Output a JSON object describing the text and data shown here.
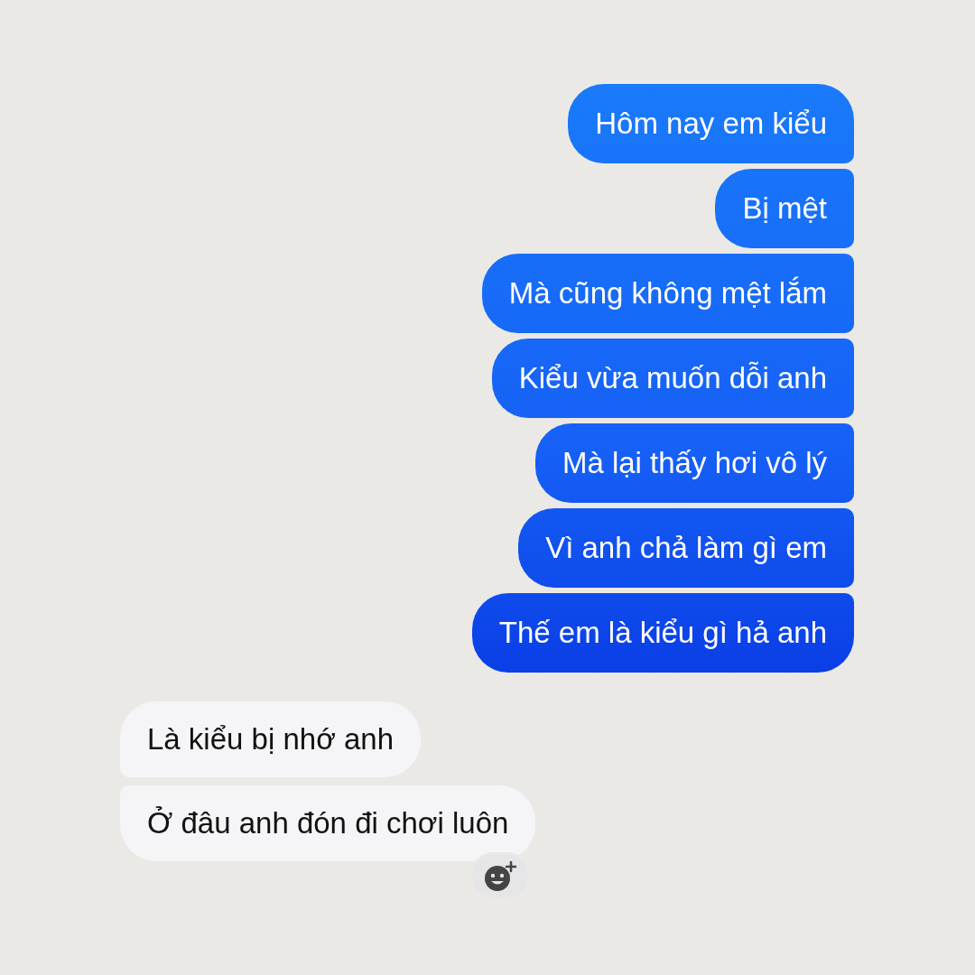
{
  "messages": [
    {
      "kind": "sent",
      "text": "Hôm nay em kiểu"
    },
    {
      "kind": "sent",
      "text": "Bị mệt"
    },
    {
      "kind": "sent",
      "text": "Mà cũng không mệt lắm"
    },
    {
      "kind": "sent",
      "text": "Kiểu vừa muốn dỗi anh"
    },
    {
      "kind": "sent",
      "text": "Mà lại thấy hơi vô lý"
    },
    {
      "kind": "sent",
      "text": "Vì anh chả làm gì em"
    },
    {
      "kind": "sent",
      "text": "Thế em là kiểu gì hả anh"
    },
    {
      "kind": "received",
      "text": "Là kiểu bị nhớ anh"
    },
    {
      "kind": "received",
      "text": "Ở đâu anh đón đi chơi luôn"
    }
  ]
}
